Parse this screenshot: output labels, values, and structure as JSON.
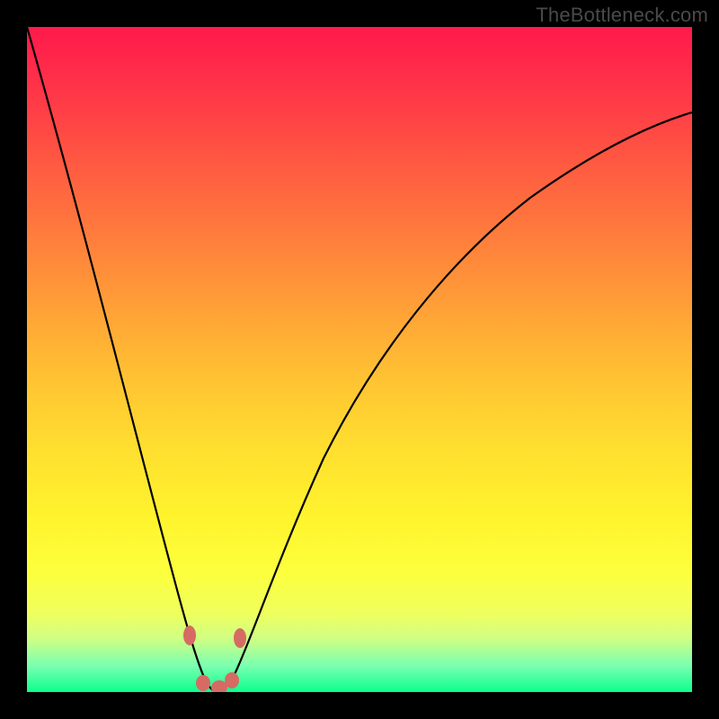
{
  "attribution": "TheBottleneck.com",
  "chart_data": {
    "type": "line",
    "title": "",
    "xlabel": "",
    "ylabel": "",
    "x_range": [
      0,
      740
    ],
    "y_range_bottleneck_pct": [
      0,
      100
    ],
    "color_scale": "0% (green, bottom) → 100% (red, top) bottleneck; curve y-position encodes bottleneck %",
    "series": [
      {
        "name": "left-branch",
        "x": [
          0,
          20,
          40,
          60,
          80,
          100,
          120,
          140,
          160,
          170,
          180,
          190,
          200,
          210
        ],
        "bottleneck_pct": [
          100,
          93,
          85,
          77,
          68,
          58,
          48,
          37,
          25,
          18,
          12,
          6,
          2,
          0
        ]
      },
      {
        "name": "right-branch",
        "x": [
          210,
          225,
          240,
          260,
          290,
          330,
          380,
          440,
          510,
          590,
          670,
          740
        ],
        "bottleneck_pct": [
          0,
          3,
          8,
          16,
          27,
          40,
          52,
          63,
          72,
          79,
          84,
          87
        ]
      }
    ],
    "optimal_x": 210,
    "markers": {
      "name": "highlight-dots",
      "x": [
        182,
        195,
        210,
        225,
        232
      ],
      "bottleneck_pct": [
        9,
        1,
        0,
        1,
        9
      ],
      "color": "#d66b63"
    }
  }
}
